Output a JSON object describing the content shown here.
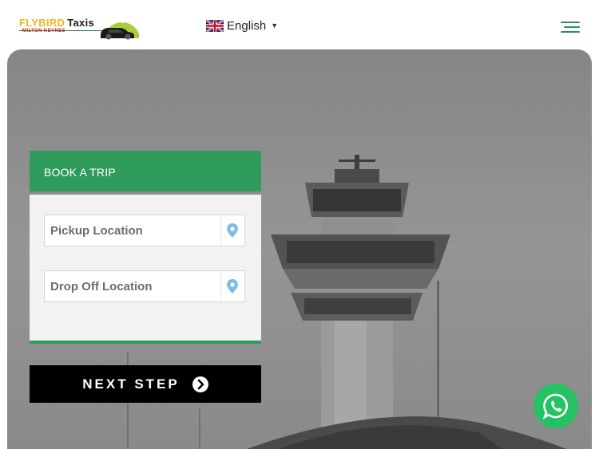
{
  "header": {
    "logo": {
      "text_part1": "FLYBIRD",
      "text_part2": "Taxis",
      "subtitle": "MILTON KEYNES"
    },
    "language": {
      "label": "English",
      "flag_icon": "uk-flag-icon",
      "caret": "▼"
    },
    "menu_icon": "hamburger-menu-icon"
  },
  "booking": {
    "title": "BOOK A TRIP",
    "pickup": {
      "placeholder": "Pickup Location",
      "value": "",
      "icon": "location-pin-icon"
    },
    "dropoff": {
      "placeholder": "Drop Off Location",
      "value": "",
      "icon": "location-pin-icon"
    },
    "next_label": "NEXT STEP",
    "next_icon": "chevron-right-circle-icon"
  },
  "floating": {
    "whatsapp_icon": "whatsapp-icon"
  },
  "colors": {
    "brand_green": "#2f9b5b",
    "logo_yellow": "#f2b61f",
    "button_black": "#000000",
    "whatsapp_green": "#25c263",
    "pin_blue": "#7fbce6"
  }
}
